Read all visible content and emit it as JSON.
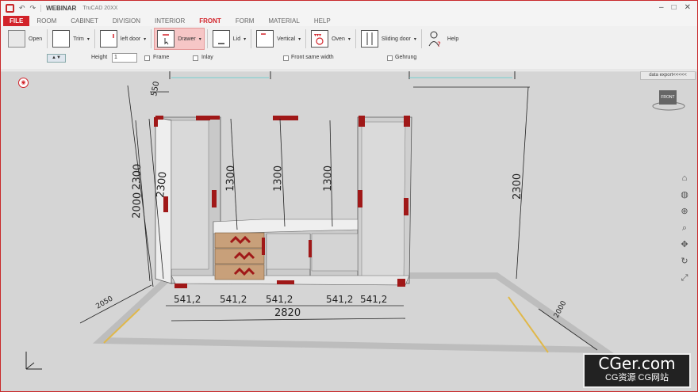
{
  "titlebar": {
    "app_tag": "WEBINAR",
    "app_version": "TruCAD 20XX",
    "min": "–",
    "max": "□",
    "close": "✕"
  },
  "menu": {
    "tabs": [
      "FILE",
      "ROOM",
      "CABINET",
      "DIVISION",
      "INTERIOR",
      "FRONT",
      "FORM",
      "MATERIAL",
      "HELP"
    ],
    "active": "FRONT"
  },
  "ribbon": {
    "tools": [
      {
        "label": "Open",
        "caret": ""
      },
      {
        "label": "Trim",
        "caret": "▾"
      },
      {
        "label": "left door",
        "caret": "▾"
      },
      {
        "label": "Drawer",
        "caret": "▾"
      },
      {
        "label": "Lid",
        "caret": "▾"
      },
      {
        "label": "Vertical",
        "caret": "▾"
      },
      {
        "label": "Oven",
        "caret": "▾"
      },
      {
        "label": "Sliding door",
        "caret": "▾"
      },
      {
        "label": "Help",
        "caret": ""
      }
    ],
    "selected_tool": "Drawer",
    "options": {
      "height_label": "Height",
      "height_value": "1",
      "frame_label": "Frame",
      "inlay_label": "Inlay",
      "front_same_width_label": "Front same width",
      "gehrung_label": "Gehrung"
    }
  },
  "viewport": {
    "data_export_label": "data export<<<<<",
    "cube_label": "FRONT",
    "dimensions": {
      "top_depth": "550",
      "left_heights": [
        "2000",
        "2300",
        "2300"
      ],
      "inner_heights": [
        "1300",
        "1300",
        "1300"
      ],
      "right_height": "2300",
      "widths": [
        "541,2",
        "541,2",
        "541,2",
        "541,2",
        "541,2"
      ],
      "total_width": "2820",
      "floor_left": "2050",
      "floor_right": "2000"
    }
  },
  "watermark": {
    "main": "CGer.com",
    "sub": "CG资源 CG网站"
  },
  "colors": {
    "accent": "#d2232a",
    "viewport_bg": "#d5d5d5",
    "drawer_wood": "#c8a07a"
  }
}
